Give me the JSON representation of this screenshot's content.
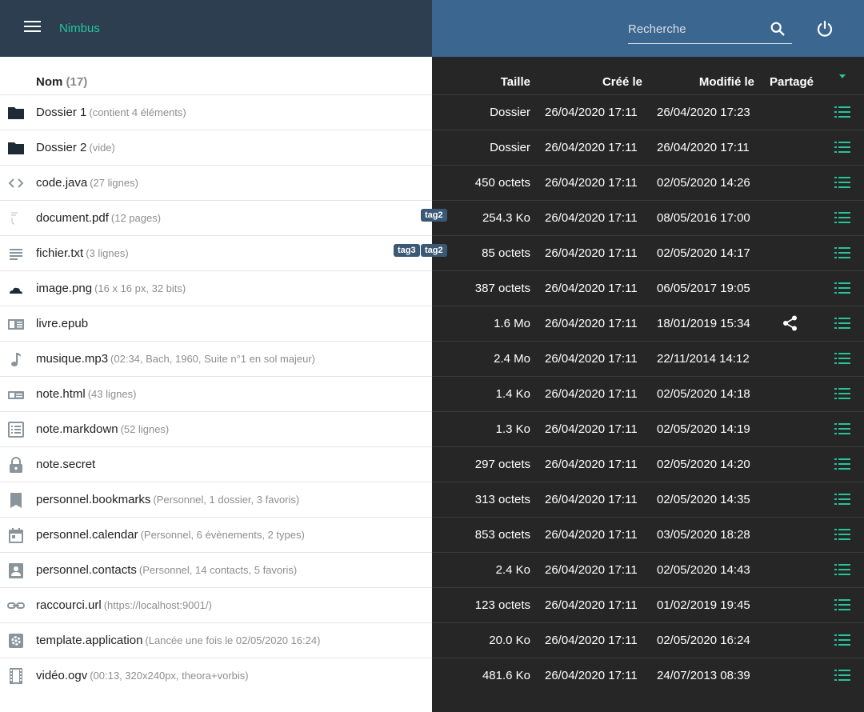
{
  "app": {
    "title": "Nimbus"
  },
  "search": {
    "placeholder": "Recherche",
    "value": ""
  },
  "colors": {
    "accent": "#27c39a",
    "header_left": "#2c3e50",
    "header_right": "#3b6690",
    "dark_panel": "#262626",
    "tag": "#3b5875"
  },
  "columns": {
    "name": "Nom",
    "count": "(17)",
    "size": "Taille",
    "created": "Créé le",
    "modified": "Modifié le",
    "shared": "Partagé"
  },
  "files": [
    {
      "icon": "folder-icon",
      "name": "Dossier 1",
      "desc": "(contient 4 éléments)",
      "tags": [],
      "size": "Dossier",
      "created": "26/04/2020 17:11",
      "modified": "26/04/2020 17:23",
      "shared": false
    },
    {
      "icon": "folder-icon",
      "name": "Dossier 2",
      "desc": "(vide)",
      "tags": [],
      "size": "Dossier",
      "created": "26/04/2020 17:11",
      "modified": "26/04/2020 17:11",
      "shared": false
    },
    {
      "icon": "code-icon",
      "name": "code.java",
      "desc": "(27 lignes)",
      "tags": [],
      "size": "450 octets",
      "created": "26/04/2020 17:11",
      "modified": "02/05/2020 14:26",
      "shared": false
    },
    {
      "icon": "pdf-icon",
      "name": "document.pdf",
      "desc": "(12 pages)",
      "tags": [
        "tag2"
      ],
      "size": "254.3 Ko",
      "created": "26/04/2020 17:11",
      "modified": "08/05/2016 17:00",
      "shared": false
    },
    {
      "icon": "text-lines-icon",
      "name": "fichier.txt",
      "desc": "(3 lignes)",
      "tags": [
        "tag3",
        "tag2"
      ],
      "size": "85 octets",
      "created": "26/04/2020 17:11",
      "modified": "02/05/2020 14:17",
      "shared": false
    },
    {
      "icon": "image-icon",
      "name": "image.png",
      "desc": "(16 x 16 px, 32 bits)",
      "tags": [],
      "size": "387 octets",
      "created": "26/04/2020 17:11",
      "modified": "06/05/2017 19:05",
      "shared": false
    },
    {
      "icon": "book-icon",
      "name": "livre.epub",
      "desc": "",
      "tags": [],
      "size": "1.6 Mo",
      "created": "26/04/2020 17:11",
      "modified": "18/01/2019 15:34",
      "shared": true
    },
    {
      "icon": "music-note-icon",
      "name": "musique.mp3",
      "desc": "(02:34, Bach, 1960, Suite n°1 en sol majeur)",
      "tags": [],
      "size": "2.4 Mo",
      "created": "26/04/2020 17:11",
      "modified": "22/11/2014 14:12",
      "shared": false
    },
    {
      "icon": "html-card-icon",
      "name": "note.html",
      "desc": "(43 lignes)",
      "tags": [],
      "size": "1.4 Ko",
      "created": "26/04/2020 17:11",
      "modified": "02/05/2020 14:18",
      "shared": false
    },
    {
      "icon": "markdown-list-icon",
      "name": "note.markdown",
      "desc": "(52 lignes)",
      "tags": [],
      "size": "1.3 Ko",
      "created": "26/04/2020 17:11",
      "modified": "02/05/2020 14:19",
      "shared": false
    },
    {
      "icon": "lock-icon",
      "name": "note.secret",
      "desc": "",
      "tags": [],
      "size": "297 octets",
      "created": "26/04/2020 17:11",
      "modified": "02/05/2020 14:20",
      "shared": false
    },
    {
      "icon": "bookmark-icon",
      "name": "personnel.bookmarks",
      "desc": "(Personnel, 1 dossier, 3 favoris)",
      "tags": [],
      "size": "313 octets",
      "created": "26/04/2020 17:11",
      "modified": "02/05/2020 14:35",
      "shared": false
    },
    {
      "icon": "calendar-icon",
      "name": "personnel.calendar",
      "desc": "(Personnel, 6 évènements, 2 types)",
      "tags": [],
      "size": "853 octets",
      "created": "26/04/2020 17:11",
      "modified": "03/05/2020 18:28",
      "shared": false
    },
    {
      "icon": "contacts-icon",
      "name": "personnel.contacts",
      "desc": "(Personnel, 14 contacts, 5 favoris)",
      "tags": [],
      "size": "2.4 Ko",
      "created": "26/04/2020 17:11",
      "modified": "02/05/2020 14:43",
      "shared": false
    },
    {
      "icon": "link-icon",
      "name": "raccourci.url",
      "desc": "(https://localhost:9001/)",
      "tags": [],
      "size": "123 octets",
      "created": "26/04/2020 17:11",
      "modified": "01/02/2019 19:45",
      "shared": false
    },
    {
      "icon": "gear-icon",
      "name": "template.application",
      "desc": "(Lancée une fois le 02/05/2020 16:24)",
      "tags": [],
      "size": "20.0 Ko",
      "created": "26/04/2020 17:11",
      "modified": "02/05/2020 16:24",
      "shared": false
    },
    {
      "icon": "video-film-icon",
      "name": "vidéo.ogv",
      "desc": "(00:13, 320x240px, theora+vorbis)",
      "tags": [],
      "size": "481.6 Ko",
      "created": "26/04/2020 17:11",
      "modified": "24/07/2013 08:39",
      "shared": false
    }
  ]
}
